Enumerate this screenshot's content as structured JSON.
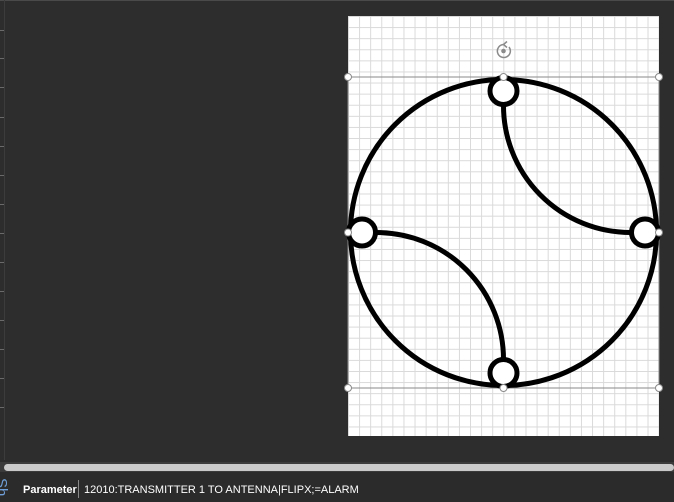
{
  "status_bar": {
    "side_tab_label": "Sh",
    "parameter_label": "Parameter",
    "parameter_value": "12010:TRANSMITTER 1 TO ANTENNA|FLIPX;=ALARM"
  },
  "canvas": {
    "shape_stroke_color": "#000000",
    "selection_color": "#888888",
    "page_color": "#ffffff",
    "grid_color": "#d9d9d9",
    "rotate_handle_icon": "rotate-handle-icon"
  }
}
